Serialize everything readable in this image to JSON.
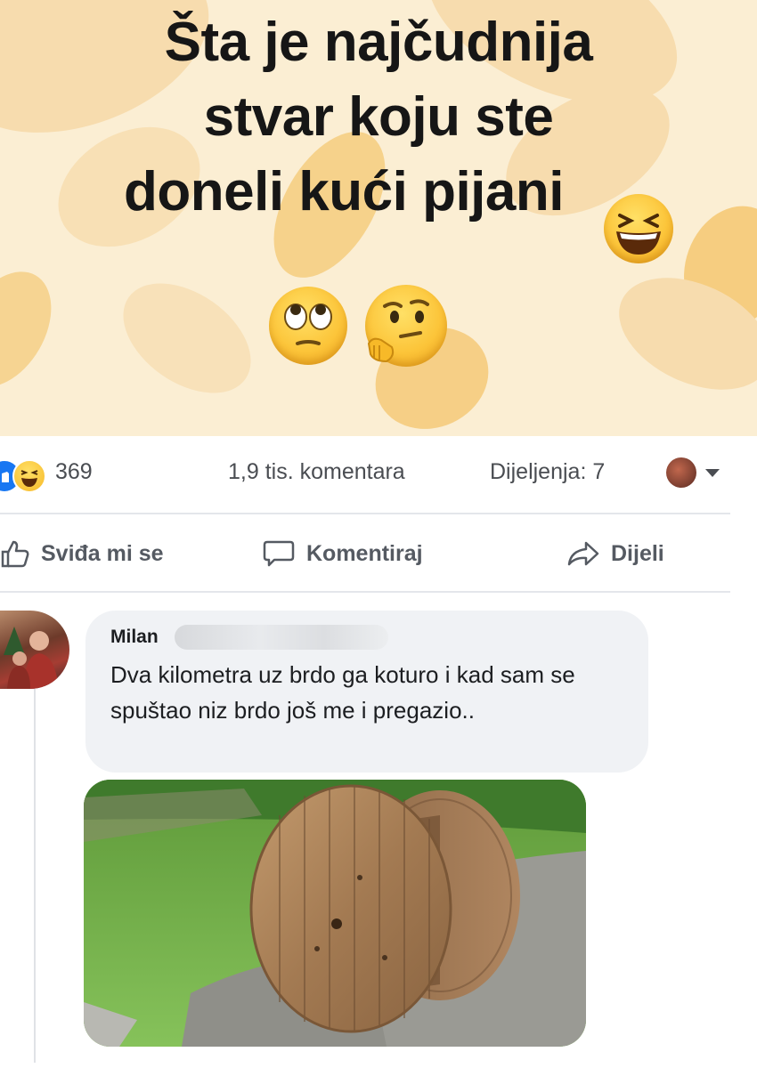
{
  "post": {
    "title_lines": [
      "Šta je najčudnija",
      "stvar koju ste",
      "doneli kući pijani"
    ],
    "emojis": [
      "laughing-squinting-face",
      "face-with-rolling-eyes",
      "thinking-face"
    ],
    "background_colors": {
      "base": "#fbeed3",
      "light": "#f7dcae",
      "gold": "#f3bf5c"
    }
  },
  "stats": {
    "reactions_count": "369",
    "comments_text": "1,9 tis. komentara",
    "shares_text": "Dijeljenja: 7"
  },
  "actions": {
    "like_label": "Sviđa mi se",
    "comment_label": "Komentiraj",
    "share_label": "Dijeli"
  },
  "comment": {
    "author_first_name": "Milan",
    "text": "Dva kilometra uz brdo ga koturo i kad sam se spuštao niz brdo još me i pregazio..",
    "image_subject": "wooden-cable-spool"
  },
  "colors": {
    "accent_blue": "#1877f2",
    "secondary_text": "#4a4d52",
    "comment_bubble": "#f0f2f5"
  }
}
